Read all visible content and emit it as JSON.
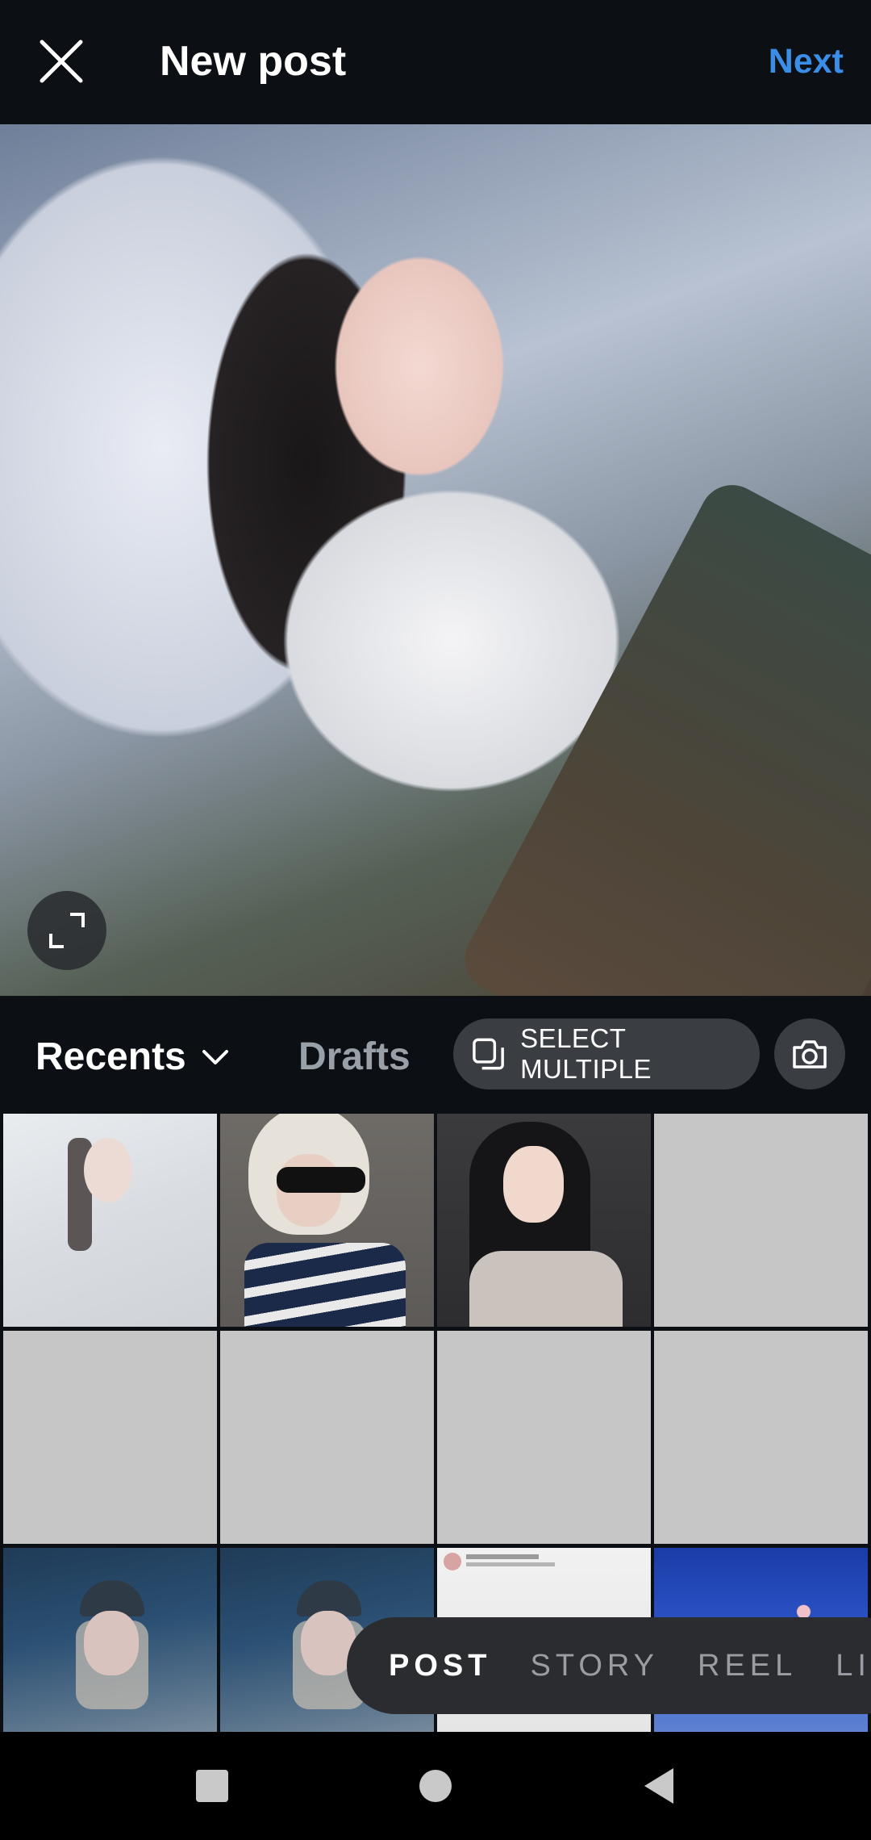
{
  "header": {
    "title": "New post",
    "next_label": "Next",
    "close_icon": "close-icon"
  },
  "preview": {
    "expand_icon": "expand-icon"
  },
  "toolbar": {
    "recents_label": "Recents",
    "drafts_label": "Drafts",
    "select_multiple_label": "SELECT MULTIPLE",
    "camera_icon": "camera-icon"
  },
  "grid": {
    "thumbnail_count": 16,
    "selected_index": 0
  },
  "modes": [
    "POST",
    "STORY",
    "REEL",
    "LIVE"
  ],
  "active_mode": "POST",
  "colors": {
    "background": "#0c0f14",
    "accent": "#3a8ee8",
    "pill": "#3a3d42",
    "placeholder": "#c6c6c6"
  }
}
